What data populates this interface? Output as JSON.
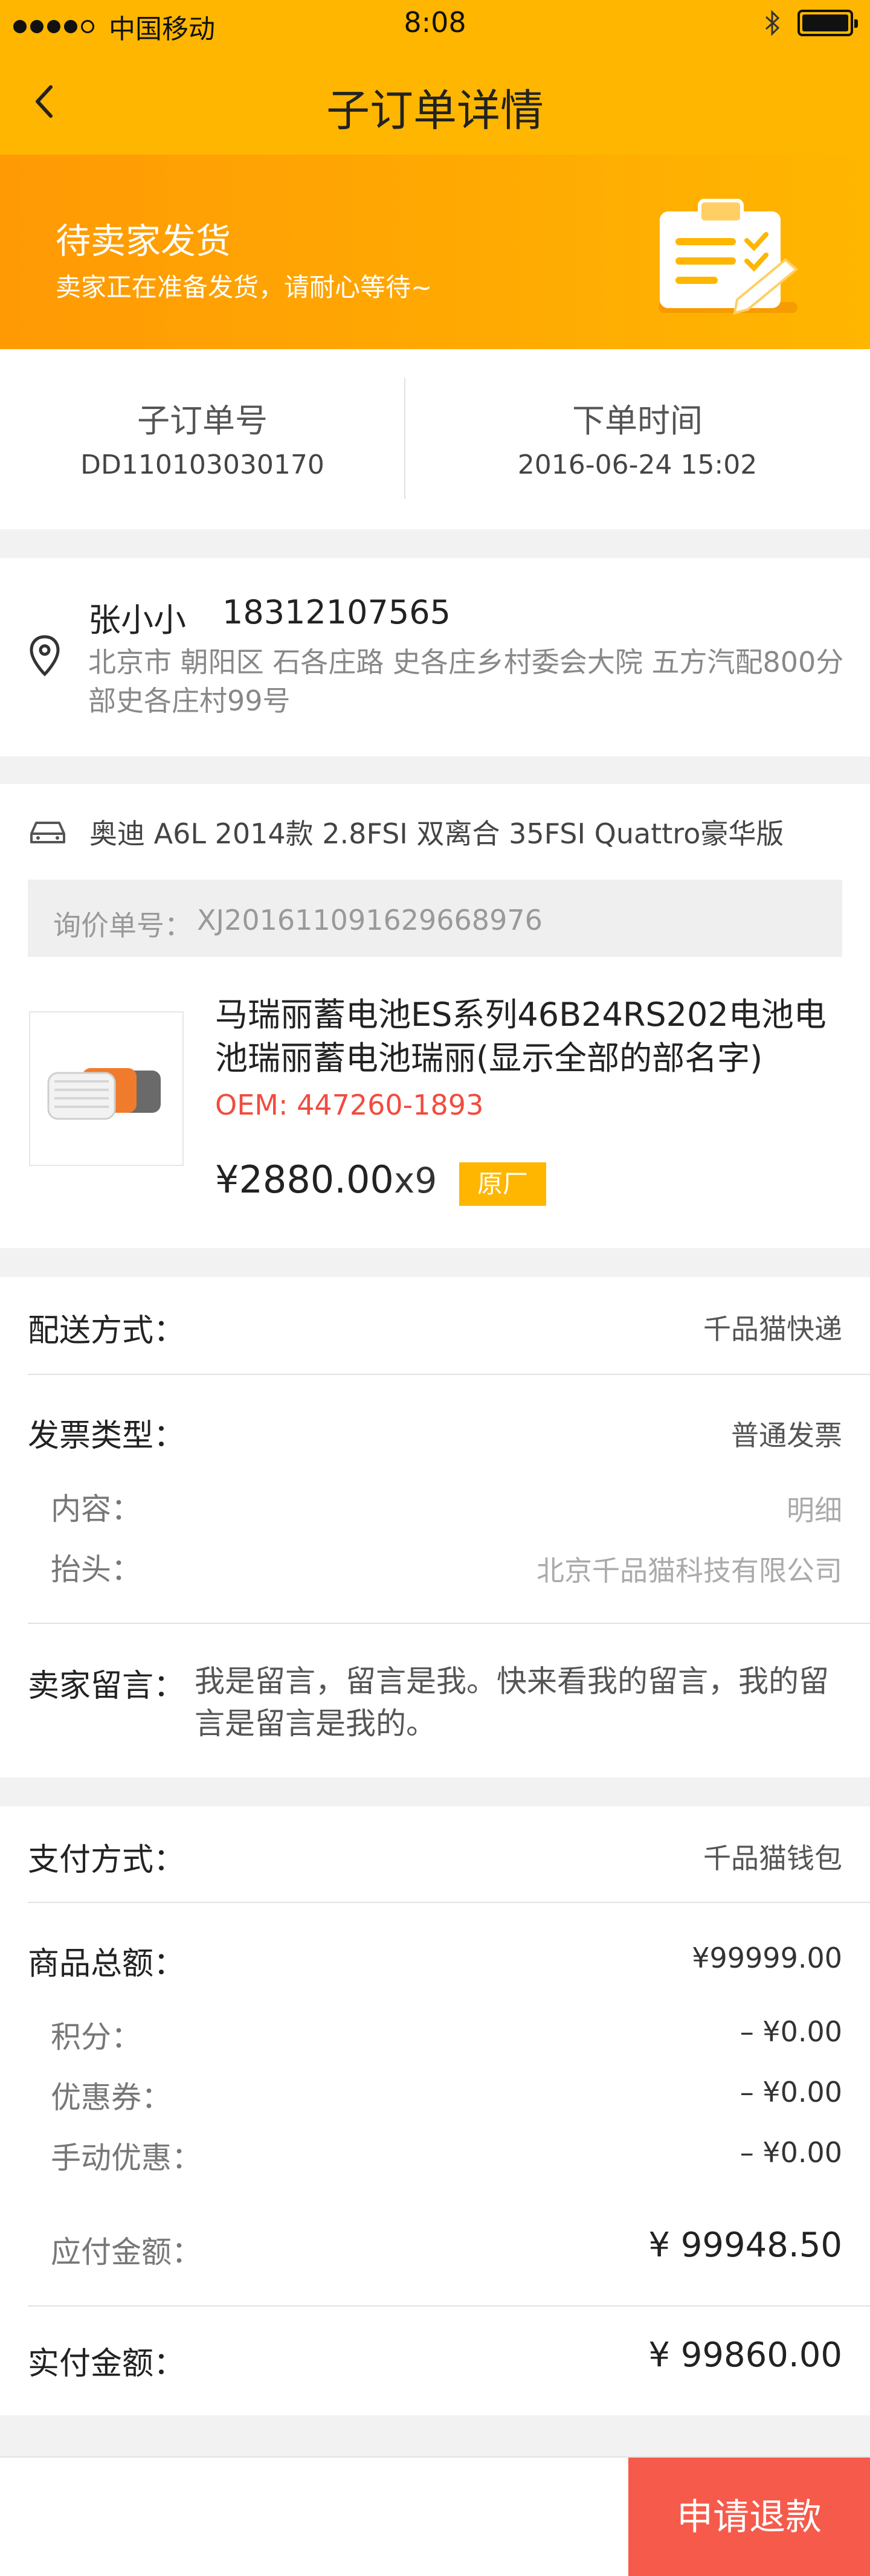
{
  "status_bar": {
    "carrier": "中国移动",
    "time": "8:08",
    "bluetooth": "bluetooth-icon",
    "battery": "battery-icon"
  },
  "nav": {
    "title": "子订单详情",
    "back_icon": "back-arrow-icon"
  },
  "banner": {
    "title": "待卖家发货",
    "subtitle": "卖家正在准备发货，请耐心等待~",
    "icon": "clipboard-check-icon"
  },
  "order": {
    "number_label": "子订单号",
    "number": "DD110103030170",
    "time_label": "下单时间",
    "time": "2016-06-24  15:02"
  },
  "address": {
    "name": "张小小",
    "phone": "18312107565",
    "detail": "北京市 朝阳区 石各庄路 史各庄乡村委会大院 五方汽配800分部史各庄村99号"
  },
  "product": {
    "car_model": "奥迪 A6L 2014款 2.8FSI 双离合 35FSI Quattro豪华版",
    "inquiry_label": "询价单号：",
    "inquiry_no": "XJ201611091629668976",
    "name": "马瑞丽蓄电池ES系列46B24RS202电池电池瑞丽蓄电池瑞丽(显示全部的部名字)",
    "oem": "OEM: 447260-1893",
    "price": "¥2880.00",
    "qty": "x9",
    "badge": "原厂"
  },
  "delivery": {
    "shipping_label": "配送方式：",
    "shipping_value": "千品猫快递",
    "invoice_label": "发票类型：",
    "invoice_value": "普通发票",
    "content_label": "内容：",
    "content_value": "明细",
    "header_label": "抬头：",
    "header_value": "北京千品猫科技有限公司",
    "remark_label": "卖家留言：",
    "remark_value": "我是留言，留言是我。快来看我的留言，我的留言是留言是我的。"
  },
  "payment": {
    "method_label": "支付方式：",
    "method_value": "千品猫钱包",
    "total_label": "商品总额：",
    "total_value": "¥99999.00",
    "points_label": "积分：",
    "points_value": "– ¥0.00",
    "coupon_label": "优惠券：",
    "coupon_value": "– ¥0.00",
    "manual_label": "手动优惠：",
    "manual_value": "– ¥0.00",
    "payable_label": "应付金额：",
    "payable_value": "¥ 99948.50",
    "paid_label": "实付金额：",
    "paid_value": "¥ 99860.00"
  },
  "actions": {
    "refund_label": "申请退款"
  },
  "colors": {
    "brand": "#ffb600",
    "banner_start": "#ff9a05",
    "oem_red": "#f24b3f",
    "refund": "#f65a4b"
  }
}
